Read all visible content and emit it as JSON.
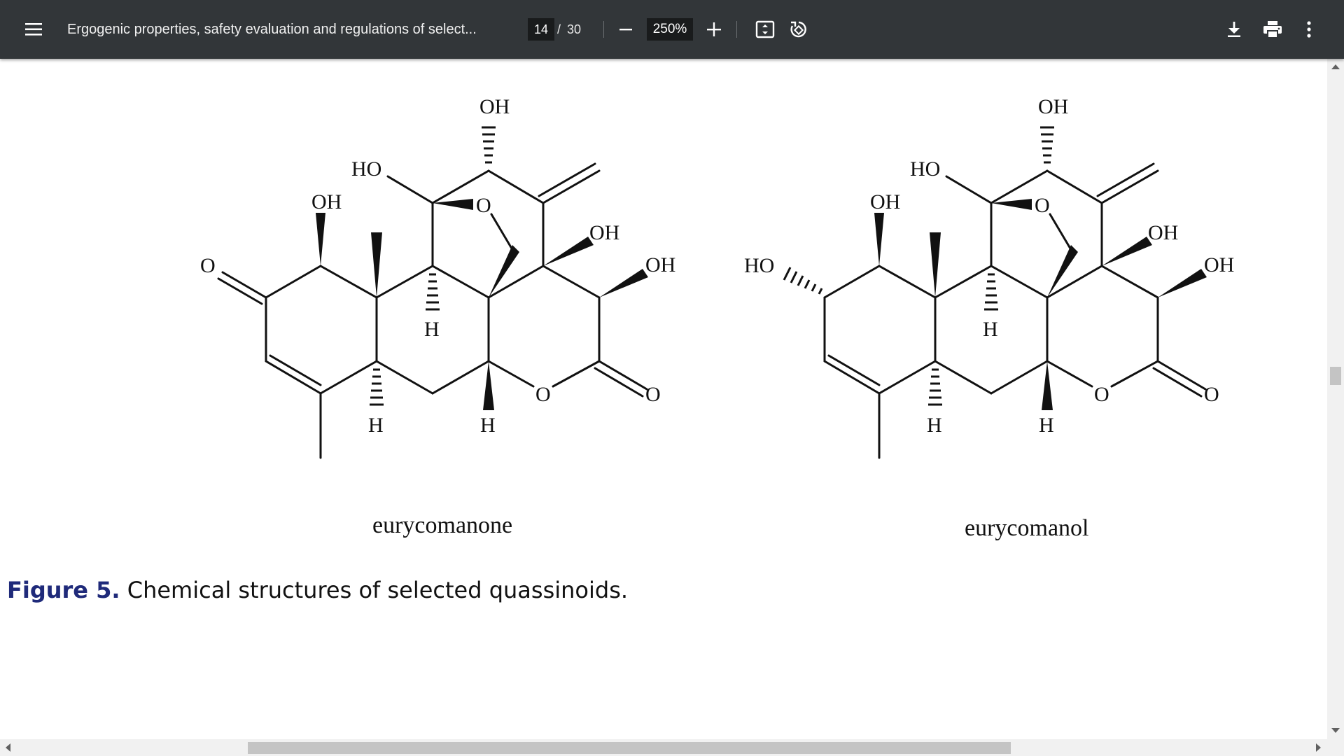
{
  "toolbar": {
    "menu_icon": "hamburger-menu-icon",
    "title": "Ergogenic properties, safety evaluation and regulations of select...",
    "current_page": "14",
    "page_separator": "/",
    "total_pages": "30",
    "zoom_level": "250%",
    "icons": [
      "zoom-out-icon",
      "zoom-in-icon",
      "fit-to-page-icon",
      "rotate-icon",
      "download-icon",
      "print-icon",
      "more-options-icon"
    ]
  },
  "figure": {
    "molecules": [
      {
        "name": "eurycomanone",
        "atom_labels": [
          "OH",
          "HO",
          "OH",
          "O",
          "O",
          "OH",
          "OH",
          "H",
          "H",
          "H",
          "O",
          "O"
        ]
      },
      {
        "name": "eurycomanol",
        "atom_labels": [
          "OH",
          "HO",
          "OH",
          "HO",
          "O",
          "OH",
          "OH",
          "H",
          "H",
          "H",
          "O",
          "O"
        ]
      }
    ],
    "caption_label": "Figure 5.",
    "caption_text": " Chemical structures of selected quassinoids."
  },
  "colors": {
    "toolbar_bg": "#323639",
    "figure_label": "#1f2a7a",
    "scrollbar_thumb": "#c4c4c4"
  }
}
